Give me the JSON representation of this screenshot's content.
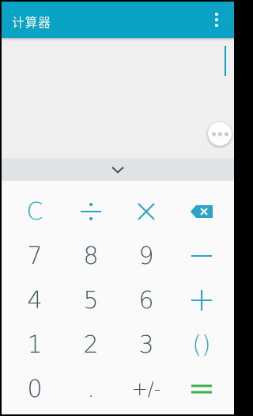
{
  "app": {
    "title": "计算器"
  },
  "colors": {
    "appbar": "#0aa3c6",
    "operator": "#2aa4c8",
    "digit": "#3e5863",
    "equals": "#3bb34a"
  },
  "icons": {
    "overflow": "more-vert-icon",
    "more": "more-horiz-icon",
    "collapse": "chevron-down-icon",
    "backspace": "backspace-icon",
    "divide": "divide-icon",
    "multiply": "multiply-icon",
    "minus": "minus-icon",
    "plus": "plus-icon",
    "equals": "equals-icon"
  },
  "keys": {
    "clear": "C",
    "seven": "7",
    "eight": "8",
    "nine": "9",
    "four": "4",
    "five": "5",
    "six": "6",
    "one": "1",
    "two": "2",
    "three": "3",
    "parens": "()",
    "zero": "0",
    "dot": ".",
    "sign": "+/-"
  }
}
